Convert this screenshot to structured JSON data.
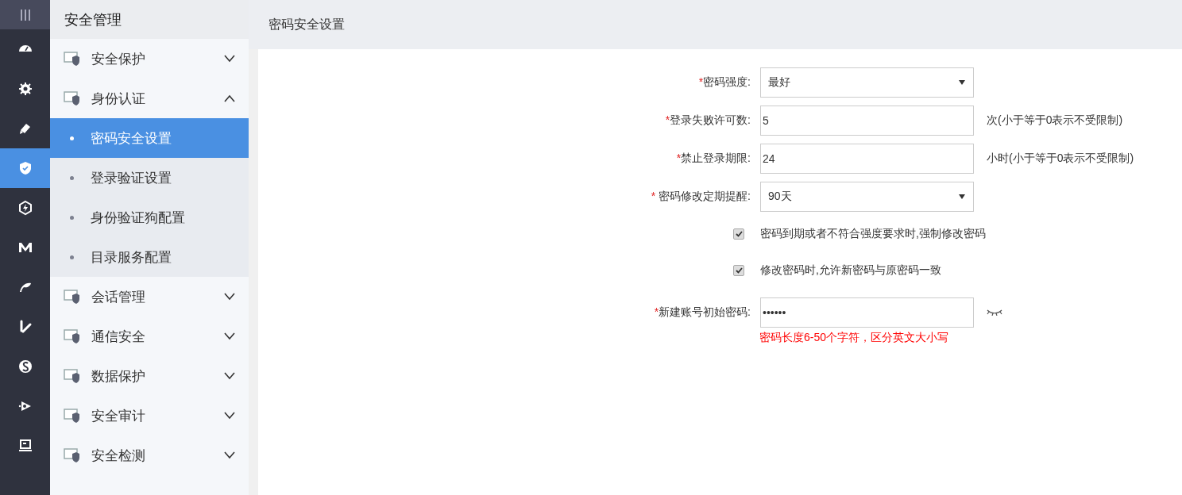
{
  "rail": [
    {
      "selected": false
    },
    {
      "selected": false
    },
    {
      "selected": false
    },
    {
      "selected": true
    },
    {
      "selected": false
    },
    {
      "selected": false
    },
    {
      "selected": false
    },
    {
      "selected": false
    },
    {
      "selected": false
    },
    {
      "selected": false
    },
    {
      "selected": false
    }
  ],
  "sidebar": {
    "title": "安全管理",
    "items": [
      {
        "label": "安全保护",
        "expanded": false
      },
      {
        "label": "身份认证",
        "expanded": true,
        "children": [
          {
            "label": "密码安全设置",
            "selected": true
          },
          {
            "label": "登录验证设置",
            "selected": false
          },
          {
            "label": "身份验证狗配置",
            "selected": false
          },
          {
            "label": "目录服务配置",
            "selected": false
          }
        ]
      },
      {
        "label": "会话管理",
        "expanded": false
      },
      {
        "label": "通信安全",
        "expanded": false
      },
      {
        "label": "数据保护",
        "expanded": false
      },
      {
        "label": "安全审计",
        "expanded": false
      },
      {
        "label": "安全检测",
        "expanded": false
      }
    ]
  },
  "page": {
    "title": "密码安全设置"
  },
  "form": [
    {
      "kind": "select",
      "required": "*",
      "label": "密码强度:",
      "value": "最好"
    },
    {
      "kind": "text",
      "required": "*",
      "label": "登录失败许可数:",
      "value": "5",
      "note": "次(小于等于0表示不受限制)"
    },
    {
      "kind": "text",
      "required": "*",
      "label": "禁止登录期限:",
      "value": "24",
      "note": "小时(小于等于0表示不受限制)"
    },
    {
      "kind": "select",
      "required": "* ",
      "label": "密码修改定期提醒:",
      "value": "90天"
    },
    {
      "kind": "checkbox",
      "checked": true,
      "label": "密码到期或者不符合强度要求时,强制修改密码"
    },
    {
      "kind": "checkbox",
      "checked": true,
      "label": "修改密码时,允许新密码与原密码一致"
    },
    {
      "kind": "password",
      "required": "*",
      "label": "新建账号初始密码:",
      "value": "••••••",
      "hint": "密码长度6-50个字符，区分英文大小写"
    }
  ]
}
